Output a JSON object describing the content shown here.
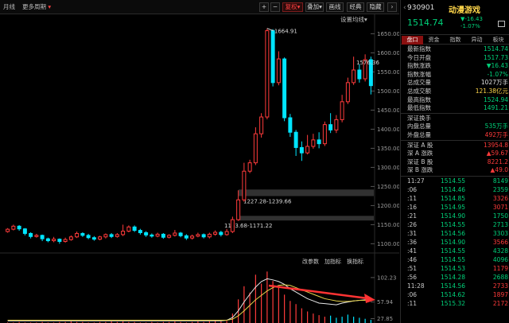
{
  "toolbar": {
    "items": [
      "月线",
      "更多周期"
    ],
    "buttons": [
      "+",
      "−",
      "复权",
      "叠加",
      "画线",
      "经典",
      "隐藏"
    ],
    "active_button": "复权",
    "settings_label": "设置均线"
  },
  "colors": {
    "up": "#ff3b3b",
    "down": "#00e5ff",
    "green": "#00d27a",
    "red": "#ff3b3b",
    "yellow": "#ffd64a",
    "ma_white": "#e8e8e8",
    "ma_yellow": "#e8d44a",
    "arrow": "#ff3333"
  },
  "chart_data": {
    "type": "candlestick",
    "y_ticks": [
      "1650.00",
      "1600.00",
      "1550.00",
      "1500.00",
      "1450.00",
      "1400.00",
      "1350.00",
      "1300.00",
      "1250.00",
      "1200.00",
      "1150.00",
      "1100.00"
    ],
    "ylim": [
      1080,
      1680
    ],
    "candles": [
      {
        "o": 1132,
        "c": 1138,
        "h": 1141,
        "l": 1129
      },
      {
        "o": 1138,
        "c": 1146,
        "h": 1150,
        "l": 1135
      },
      {
        "o": 1146,
        "c": 1139,
        "h": 1149,
        "l": 1134
      },
      {
        "o": 1139,
        "c": 1127,
        "h": 1141,
        "l": 1122
      },
      {
        "o": 1127,
        "c": 1119,
        "h": 1130,
        "l": 1114
      },
      {
        "o": 1119,
        "c": 1122,
        "h": 1126,
        "l": 1116
      },
      {
        "o": 1122,
        "c": 1113,
        "h": 1124,
        "l": 1107
      },
      {
        "o": 1113,
        "c": 1108,
        "h": 1116,
        "l": 1104
      },
      {
        "o": 1108,
        "c": 1112,
        "h": 1118,
        "l": 1104
      },
      {
        "o": 1112,
        "c": 1106,
        "h": 1114,
        "l": 1100
      },
      {
        "o": 1106,
        "c": 1111,
        "h": 1116,
        "l": 1103
      },
      {
        "o": 1111,
        "c": 1118,
        "h": 1122,
        "l": 1108
      },
      {
        "o": 1118,
        "c": 1127,
        "h": 1132,
        "l": 1115
      },
      {
        "o": 1127,
        "c": 1122,
        "h": 1130,
        "l": 1118
      },
      {
        "o": 1122,
        "c": 1116,
        "h": 1126,
        "l": 1112
      },
      {
        "o": 1116,
        "c": 1112,
        "h": 1120,
        "l": 1108
      },
      {
        "o": 1112,
        "c": 1118,
        "h": 1121,
        "l": 1109
      },
      {
        "o": 1118,
        "c": 1124,
        "h": 1127,
        "l": 1114
      },
      {
        "o": 1124,
        "c": 1119,
        "h": 1128,
        "l": 1115
      },
      {
        "o": 1119,
        "c": 1124,
        "h": 1128,
        "l": 1116
      },
      {
        "o": 1124,
        "c": 1133,
        "h": 1150,
        "l": 1120
      },
      {
        "o": 1133,
        "c": 1144,
        "h": 1148,
        "l": 1130
      },
      {
        "o": 1144,
        "c": 1135,
        "h": 1148,
        "l": 1131
      },
      {
        "o": 1135,
        "c": 1129,
        "h": 1139,
        "l": 1124
      },
      {
        "o": 1129,
        "c": 1123,
        "h": 1133,
        "l": 1118
      },
      {
        "o": 1123,
        "c": 1120,
        "h": 1127,
        "l": 1116
      },
      {
        "o": 1120,
        "c": 1125,
        "h": 1129,
        "l": 1117
      },
      {
        "o": 1125,
        "c": 1117,
        "h": 1128,
        "l": 1113
      },
      {
        "o": 1117,
        "c": 1122,
        "h": 1125,
        "l": 1114
      },
      {
        "o": 1122,
        "c": 1128,
        "h": 1136,
        "l": 1119
      },
      {
        "o": 1128,
        "c": 1121,
        "h": 1131,
        "l": 1117
      },
      {
        "o": 1121,
        "c": 1115,
        "h": 1125,
        "l": 1110
      },
      {
        "o": 1115,
        "c": 1120,
        "h": 1124,
        "l": 1111
      },
      {
        "o": 1120,
        "c": 1124,
        "h": 1129,
        "l": 1117
      },
      {
        "o": 1124,
        "c": 1118,
        "h": 1127,
        "l": 1114
      },
      {
        "o": 1118,
        "c": 1125,
        "h": 1129,
        "l": 1114
      },
      {
        "o": 1125,
        "c": 1130,
        "h": 1135,
        "l": 1121
      },
      {
        "o": 1130,
        "c": 1124,
        "h": 1134,
        "l": 1119
      },
      {
        "o": 1124,
        "c": 1132,
        "h": 1139,
        "l": 1121
      },
      {
        "o": 1132,
        "c": 1163,
        "h": 1171,
        "l": 1128
      },
      {
        "o": 1163,
        "c": 1215,
        "h": 1240,
        "l": 1160
      },
      {
        "o": 1215,
        "c": 1290,
        "h": 1312,
        "l": 1210
      },
      {
        "o": 1290,
        "c": 1312,
        "h": 1320,
        "l": 1285
      },
      {
        "o": 1312,
        "c": 1388,
        "h": 1405,
        "l": 1306
      },
      {
        "o": 1388,
        "c": 1432,
        "h": 1442,
        "l": 1378
      },
      {
        "o": 1432,
        "c": 1658,
        "h": 1664,
        "l": 1426
      },
      {
        "o": 1658,
        "c": 1522,
        "h": 1662,
        "l": 1512
      },
      {
        "o": 1522,
        "c": 1584,
        "h": 1604,
        "l": 1515
      },
      {
        "o": 1584,
        "c": 1430,
        "h": 1588,
        "l": 1421
      },
      {
        "o": 1430,
        "c": 1392,
        "h": 1440,
        "l": 1380
      },
      {
        "o": 1392,
        "c": 1352,
        "h": 1398,
        "l": 1330
      },
      {
        "o": 1352,
        "c": 1338,
        "h": 1368,
        "l": 1317
      },
      {
        "o": 1338,
        "c": 1355,
        "h": 1385,
        "l": 1334
      },
      {
        "o": 1355,
        "c": 1372,
        "h": 1388,
        "l": 1349
      },
      {
        "o": 1372,
        "c": 1362,
        "h": 1392,
        "l": 1350
      },
      {
        "o": 1362,
        "c": 1412,
        "h": 1420,
        "l": 1356
      },
      {
        "o": 1412,
        "c": 1398,
        "h": 1442,
        "l": 1390
      },
      {
        "o": 1398,
        "c": 1425,
        "h": 1437,
        "l": 1390
      },
      {
        "o": 1425,
        "c": 1472,
        "h": 1490,
        "l": 1418
      },
      {
        "o": 1472,
        "c": 1522,
        "h": 1535,
        "l": 1466
      },
      {
        "o": 1522,
        "c": 1555,
        "h": 1590,
        "l": 1516
      },
      {
        "o": 1555,
        "c": 1532,
        "h": 1570,
        "l": 1522
      },
      {
        "o": 1532,
        "c": 1582,
        "h": 1596,
        "l": 1525
      },
      {
        "o": 1582,
        "c": 1514,
        "h": 1590,
        "l": 1491
      }
    ],
    "annotations": {
      "high_label": "1664.91",
      "right_label": "1576.36",
      "zone1_label": "1227.28-1239.66",
      "zone2_label": "1163.68-1171.22"
    },
    "sub_chart": {
      "menu": [
        "改参数",
        "加指标",
        "换指标"
      ],
      "y_ticks": [
        "102.23",
        "57.94",
        "27.85"
      ],
      "ylim": [
        20,
        115
      ],
      "bars": [
        1,
        1,
        2,
        1,
        1,
        1,
        2,
        1,
        1,
        2,
        2,
        3,
        2,
        2,
        1,
        1,
        2,
        2,
        3,
        2,
        3,
        2,
        2,
        1,
        1,
        2,
        1,
        2,
        2,
        3,
        2,
        1,
        2,
        3,
        2,
        3,
        4,
        3,
        4,
        18,
        45,
        70,
        58,
        92,
        75,
        98,
        80,
        68,
        54,
        42,
        36,
        28,
        22,
        18,
        15,
        12,
        14,
        10,
        12,
        16,
        12,
        10,
        8,
        6
      ],
      "bar_colors": "mixed",
      "ma_white": [
        24,
        24,
        24,
        24,
        24,
        24,
        24,
        24,
        24,
        24,
        24,
        24,
        24,
        24,
        24,
        24,
        24,
        24,
        24,
        24,
        24,
        24,
        24,
        24,
        24,
        24,
        24,
        24,
        24,
        24,
        24,
        24,
        24,
        24,
        24,
        24,
        24,
        24,
        25,
        30,
        42,
        58,
        72,
        85,
        95,
        100,
        98,
        95,
        90,
        82,
        76,
        70,
        64,
        60,
        56,
        55,
        54,
        53,
        56,
        58,
        60,
        61,
        62,
        62
      ],
      "ma_yellow": [
        25,
        25,
        25,
        25,
        25,
        25,
        25,
        25,
        25,
        25,
        25,
        25,
        25,
        25,
        25,
        25,
        25,
        25,
        25,
        25,
        25,
        25,
        25,
        25,
        25,
        25,
        25,
        25,
        25,
        25,
        25,
        25,
        25,
        25,
        25,
        25,
        25,
        25,
        25,
        27,
        33,
        42,
        52,
        62,
        70,
        78,
        84,
        88,
        89,
        88,
        84,
        80,
        76,
        72,
        68,
        64,
        62,
        60,
        59,
        59,
        60,
        61,
        61,
        62
      ]
    }
  },
  "panel": {
    "code": "930901",
    "name": "动漫游戏",
    "price": "1514.74",
    "change": "-16.43",
    "change_pct": "-1.07%",
    "tabs": [
      "盘口",
      "资金",
      "指数",
      "异动",
      "板块"
    ],
    "stats": [
      {
        "k": "最新指数",
        "v": "1514.74",
        "c": "green"
      },
      {
        "k": "今日开盘",
        "v": "1517.73",
        "c": "green"
      },
      {
        "k": "指数涨跌",
        "v": "▼16.43",
        "c": "green"
      },
      {
        "k": "指数涨幅",
        "v": "-1.07%",
        "c": "green"
      },
      {
        "k": "总成交量",
        "v": "1027万手",
        "c": "white"
      },
      {
        "k": "总成交额",
        "v": "121.38亿元",
        "c": "yellow"
      },
      {
        "k": "最高指数",
        "v": "1524.94",
        "c": "green"
      },
      {
        "k": "最低指数",
        "v": "1491.21",
        "c": "green"
      }
    ],
    "stats2": [
      {
        "k": "深证换手",
        "v": "",
        "c": "white"
      },
      {
        "k": "内盘总量",
        "v": "535万手",
        "c": "green"
      },
      {
        "k": "外盘总量",
        "v": "492万手",
        "c": "red"
      }
    ],
    "stats3": [
      {
        "k": "深证 A 股",
        "v": "13954.8",
        "c": "red"
      },
      {
        "k": "深 A 涨跌",
        "v": "▲59.67",
        "c": "red"
      },
      {
        "k": "深证 B 股",
        "v": "8221.2",
        "c": "red"
      },
      {
        "k": "深 B 涨跌",
        "v": "▲49.0",
        "c": "red"
      }
    ],
    "ticks": [
      {
        "t": "11:27",
        "p": "1514.55",
        "q": "8149",
        "c": "green"
      },
      {
        "t": ":06",
        "p": "1514.46",
        "q": "2359",
        "c": "green"
      },
      {
        "t": ":11",
        "p": "1514.85",
        "q": "3326",
        "c": "red"
      },
      {
        "t": ":16",
        "p": "1514.95",
        "q": "3071",
        "c": "red"
      },
      {
        "t": ":21",
        "p": "1514.90",
        "q": "1750",
        "c": "green"
      },
      {
        "t": ":26",
        "p": "1514.55",
        "q": "2713",
        "c": "green"
      },
      {
        "t": ":31",
        "p": "1514.56",
        "q": "3303",
        "c": "green"
      },
      {
        "t": ":36",
        "p": "1514.90",
        "q": "3566",
        "c": "red"
      },
      {
        "t": ":41",
        "p": "1514.55",
        "q": "4328",
        "c": "green"
      },
      {
        "t": ":46",
        "p": "1514.55",
        "q": "4096",
        "c": "green"
      },
      {
        "t": ":51",
        "p": "1514.53",
        "q": "1179",
        "c": "red"
      },
      {
        "t": ":56",
        "p": "1514.28",
        "q": "2688",
        "c": "green"
      },
      {
        "t": "11:28",
        "p": "1514.56",
        "q": "2733",
        "c": "red"
      },
      {
        "t": ":06",
        "p": "1514.62",
        "q": "1897",
        "c": "red"
      },
      {
        "t": ":11",
        "p": "1515.32",
        "q": "2172",
        "c": "red"
      }
    ]
  }
}
